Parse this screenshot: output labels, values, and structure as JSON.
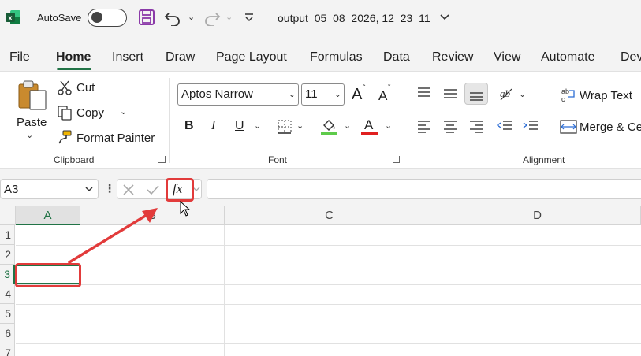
{
  "titlebar": {
    "autosave_label": "AutoSave",
    "doc_title": "output_05_08_2026, 12_23_11_"
  },
  "menu": {
    "tabs": [
      "File",
      "Home",
      "Insert",
      "Draw",
      "Page Layout",
      "Formulas",
      "Data",
      "Review",
      "View",
      "Automate",
      "Dev"
    ],
    "active": "Home"
  },
  "ribbon": {
    "clipboard": {
      "paste": "Paste",
      "cut": "Cut",
      "copy": "Copy",
      "format_painter": "Format Painter",
      "label": "Clipboard"
    },
    "font": {
      "name": "Aptos Narrow",
      "size": "11",
      "bold": "B",
      "italic": "I",
      "underline": "U",
      "font_color_glyph": "A",
      "grow_glyph": "A",
      "shrink_glyph": "A",
      "label": "Font"
    },
    "alignment": {
      "wrap_text": "Wrap Text",
      "merge_center": "Merge & Ce",
      "label": "Alignment"
    }
  },
  "formula_bar": {
    "name_box": "A3",
    "fx": "fx",
    "formula": ""
  },
  "grid": {
    "columns": [
      "A",
      "B",
      "C",
      "D"
    ],
    "rows": [
      "1",
      "2",
      "3",
      "4",
      "5",
      "6",
      "7"
    ],
    "selected_cell": "A3"
  },
  "colors": {
    "accent": "#217346",
    "annotation": "#e23b3b"
  }
}
